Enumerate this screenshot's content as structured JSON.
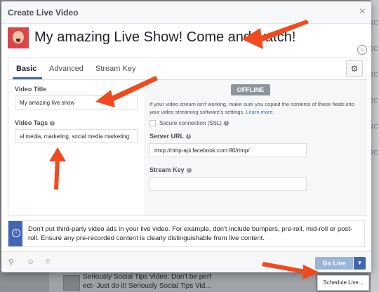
{
  "modal": {
    "title": "Create Live Video",
    "close_icon": "×",
    "live_title": "My amazing Live Show! Come and watch!"
  },
  "tabs": [
    {
      "label": "Basic",
      "active": true
    },
    {
      "label": "Advanced",
      "active": false
    },
    {
      "label": "Stream Key",
      "active": false
    }
  ],
  "video_title": {
    "label": "Video Title",
    "value": "My amazing live show"
  },
  "video_tags": {
    "label": "Video Tags",
    "value": "al media, marketing, social media marketing"
  },
  "stream": {
    "status": "OFFLINE",
    "message": "If your video stream isn't working, make sure you copied the contents of these fields into your video streaming software's settings.",
    "learn_more": "Learn more.",
    "ssl_label": "Secure connection (SSL)",
    "server_url_label": "Server URL",
    "server_url_value": "rtmp://rtmp-api.facebook.com:80/rtmp/",
    "stream_key_label": "Stream Key",
    "stream_key_value": ""
  },
  "notice": "Don't put third-party video ads in your live video. For example, don't include bumpers, pre-roll, mid-roll or post-roll. Ensure any pre-recorded content is clearly distinguishable from live content.",
  "footer": {
    "go_live": "Go Live",
    "schedule": "Schedule Live..."
  },
  "background": {
    "line1": "Seriously Social Tips Video: Don't be perf",
    "line2": "ect- Just do it! Seriously Social Tips Vid...",
    "right_tick": "2C"
  },
  "colors": {
    "accent": "#4267b2",
    "annotation_arrow": "#f04a1e"
  }
}
